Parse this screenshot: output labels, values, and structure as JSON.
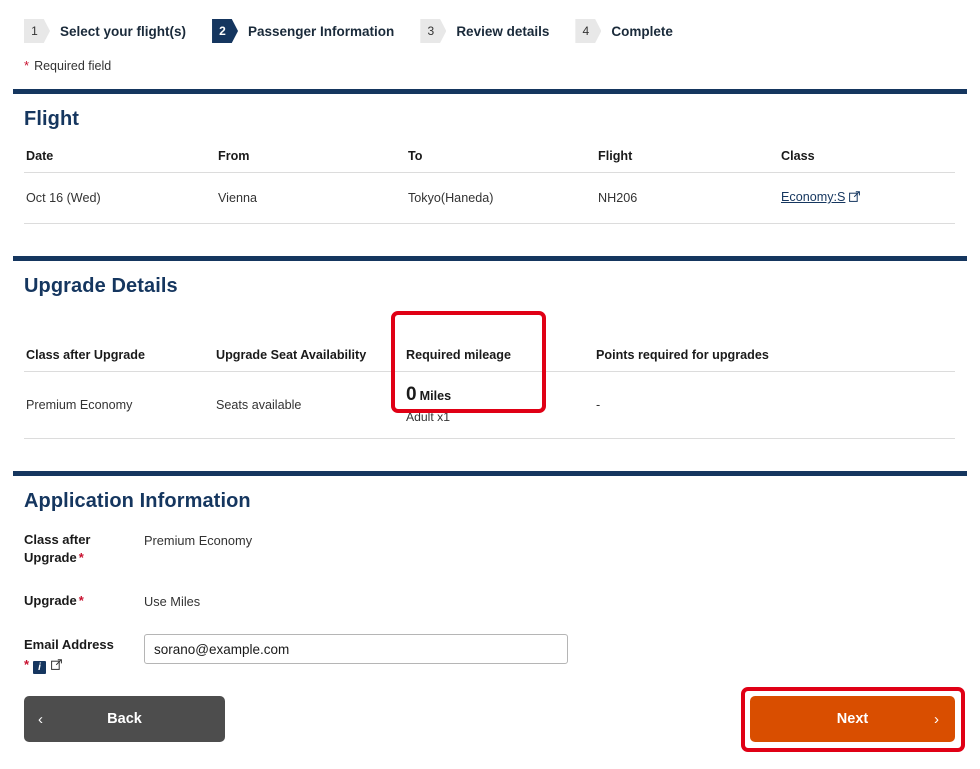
{
  "stepper": {
    "steps": [
      {
        "number": "1",
        "label": "Select your flight(s)",
        "active": false
      },
      {
        "number": "2",
        "label": "Passenger Information",
        "active": true
      },
      {
        "number": "3",
        "label": "Review details",
        "active": false
      },
      {
        "number": "4",
        "label": "Complete",
        "active": false
      }
    ]
  },
  "required_note": {
    "star": "*",
    "text": "Required field"
  },
  "flight_section": {
    "title": "Flight",
    "headers": [
      "Date",
      "From",
      "To",
      "Flight",
      "Class"
    ],
    "rows": [
      {
        "date": "Oct 16 (Wed)",
        "from": "Vienna",
        "to": "Tokyo(Haneda)",
        "flight": "NH206",
        "class_link": "Economy:S"
      }
    ]
  },
  "upgrade_section": {
    "title": "Upgrade Details",
    "headers": [
      "Class after Upgrade",
      "Upgrade Seat Availability",
      "Required mileage",
      "Points required for upgrades"
    ],
    "rows": [
      {
        "class_after_upgrade": "Premium Economy",
        "seat_availability": "Seats available",
        "miles_value": "0",
        "miles_unit": "Miles",
        "miles_sub": "Adult x1",
        "points_required": "-"
      }
    ]
  },
  "application_section": {
    "title": "Application Information",
    "fields": [
      {
        "label": "Class after Upgrade",
        "star": "*",
        "value": "Premium Economy"
      },
      {
        "label": "Upgrade",
        "star": "*",
        "value": "Use Miles"
      }
    ],
    "email": {
      "label": "Email Address",
      "star": "*",
      "info_glyph": "i",
      "value": "sorano@example.com",
      "placeholder": "Email Address"
    }
  },
  "buttons": {
    "back": {
      "label": "Back",
      "chevron": "‹"
    },
    "next": {
      "label": "Next",
      "chevron": "›"
    }
  },
  "colors": {
    "brand_navy": "#15365F",
    "accent_orange": "#D94E00",
    "required_red": "#C8102E",
    "annotation_red": "#E00015",
    "back_gray": "#4D4D4D"
  }
}
